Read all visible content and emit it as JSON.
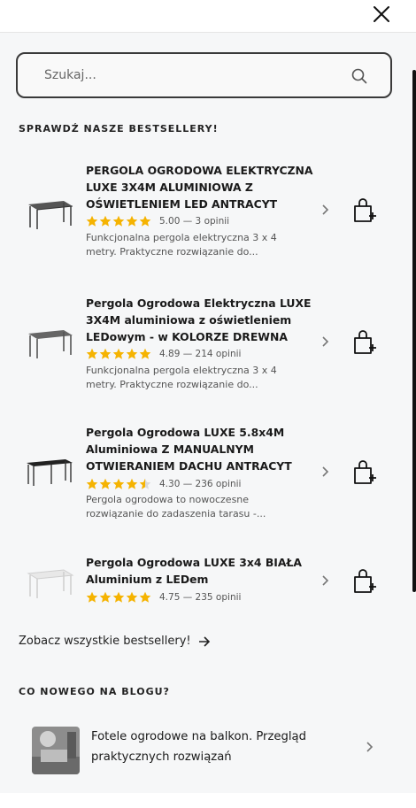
{
  "search": {
    "placeholder": "Szukaj..."
  },
  "bestsellers": {
    "title": "SPRAWDŹ NASZE BESTSELLERY!",
    "see_all": "Zobacz wszystkie bestsellery!",
    "products": [
      {
        "title": "PERGOLA OGRODOWA ELEKTRYCZNA LUXE 3X4M ALUMINIOWA Z OŚWIETLENIEM LED ANTRACYT",
        "rating": 5.0,
        "stars": 5,
        "rating_text": "5.00 — 3 opinii",
        "desc": "Funkcjonalna pergola elektryczna 3 x 4 metry. Praktyczne rozwiązanie do...",
        "image": "pergola-anthracite-icon"
      },
      {
        "title": "Pergola Ogrodowa Elektryczna LUXE 3X4M aluminiowa z oświetleniem LEDowym - w KOLORZE DREWNA",
        "rating": 4.89,
        "stars": 5,
        "rating_text": "4.89 — 214 opinii",
        "desc": "Funkcjonalna pergola elektryczna 3 x 4 metry. Praktyczne rozwiązanie do...",
        "image": "pergola-wood-icon"
      },
      {
        "title": "Pergola Ogrodowa LUXE 5.8x4M Aluminiowa Z MANUALNYM OTWIERANIEM DACHU ANTRACYT",
        "rating": 4.3,
        "stars": 4.5,
        "rating_text": "4.30 — 236 opinii",
        "desc": "Pergola ogrodowa to nowoczesne rozwiązanie do zadaszenia tarasu -...",
        "image": "pergola-large-icon"
      },
      {
        "title": "Pergola Ogrodowa LUXE 3x4 BIAŁA Aluminium z LEDem",
        "rating": 4.75,
        "stars": 5,
        "rating_text": "4.75 — 235 opinii",
        "desc": "",
        "image": "pergola-white-icon"
      }
    ]
  },
  "blog": {
    "title": "CO NOWEGO NA BLOGU?",
    "posts": [
      {
        "title": "Fotele ogrodowe na balkon. Przegląd praktycznych rozwiązań"
      }
    ]
  },
  "colors": {
    "star": "#f5b301",
    "text": "#1a1a1a",
    "accent": "#111111"
  }
}
